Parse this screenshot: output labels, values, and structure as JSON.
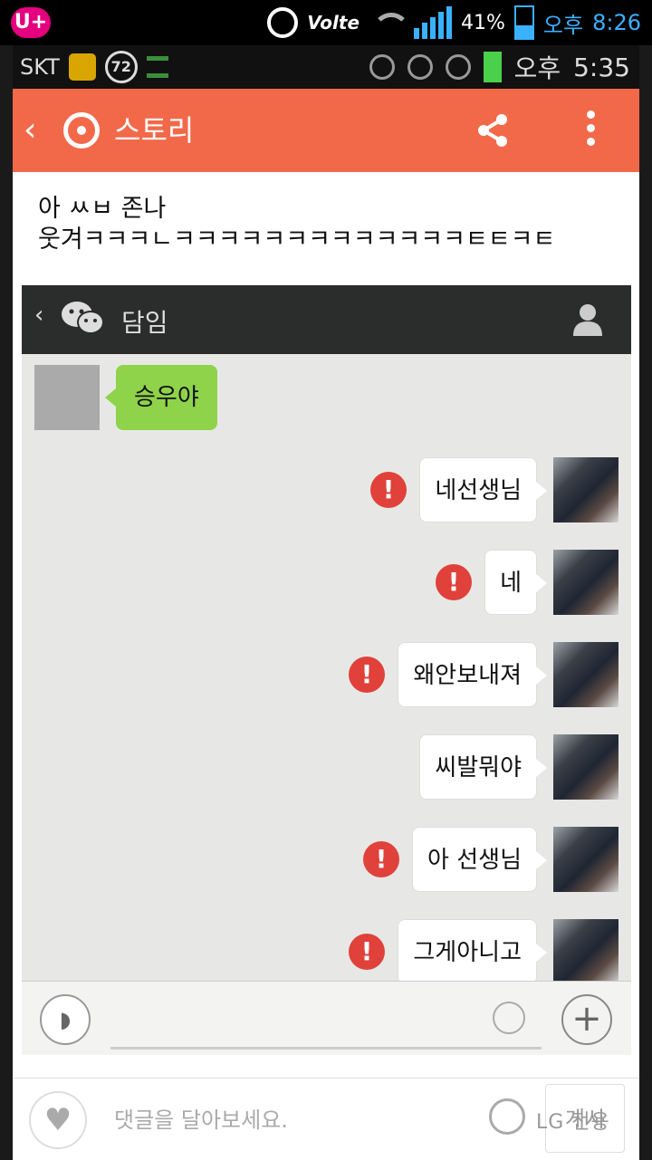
{
  "outer_status": {
    "carrier_logo": "U+",
    "volte": "Volte",
    "battery": "41%",
    "ampm": "오후",
    "time": "8:26",
    "battery_level": 0.41
  },
  "inner_status": {
    "carrier": "SKT",
    "badge": "72",
    "ampm": "오후",
    "time": "5:35"
  },
  "app_bar": {
    "back": "‹",
    "title": "스토리"
  },
  "post": {
    "line1": "아 ㅆㅂ 존나",
    "line2": "웃겨ㅋㅋㅋㄴㅋㅋㅋㅋㅋㅋㅋㅋㅋㅋㅋㅋㅋㅌㅌㅋㅌ"
  },
  "chat": {
    "title": "담임",
    "incoming": "승우야",
    "outgoing": [
      {
        "text": "네선생님",
        "error": true
      },
      {
        "text": "네",
        "error": true
      },
      {
        "text": "왜안보내져",
        "error": true
      },
      {
        "text": "씨발뭐야",
        "error": false
      },
      {
        "text": "아 선생님",
        "error": true
      },
      {
        "text": "그게아니고",
        "error": true
      }
    ],
    "error_mark": "!",
    "plus": "+"
  },
  "comment_bar": {
    "placeholder": "댓글을 달아보세요.",
    "post_label": "게시",
    "watermark": "LG 전용"
  },
  "colors": {
    "app_bar": "#f2694a",
    "incoming_bubble": "#8ed34a",
    "error": "#e0413a",
    "chat_header": "#2b2d2c"
  }
}
